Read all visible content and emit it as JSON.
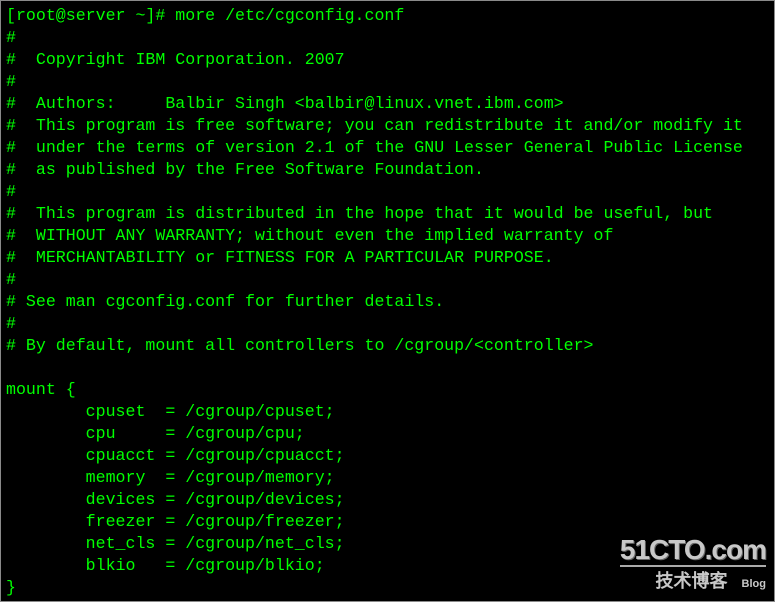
{
  "terminal": {
    "text_color": "#00ff00",
    "background": "#000000",
    "lines": [
      "[root@server ~]# more /etc/cgconfig.conf",
      "#",
      "#  Copyright IBM Corporation. 2007",
      "#",
      "#  Authors:     Balbir Singh <balbir@linux.vnet.ibm.com>",
      "#  This program is free software; you can redistribute it and/or modify it",
      "#  under the terms of version 2.1 of the GNU Lesser General Public License",
      "#  as published by the Free Software Foundation.",
      "#",
      "#  This program is distributed in the hope that it would be useful, but",
      "#  WITHOUT ANY WARRANTY; without even the implied warranty of",
      "#  MERCHANTABILITY or FITNESS FOR A PARTICULAR PURPOSE.",
      "#",
      "# See man cgconfig.conf for further details.",
      "#",
      "# By default, mount all controllers to /cgroup/<controller>",
      "",
      "mount {",
      "        cpuset  = /cgroup/cpuset;",
      "        cpu     = /cgroup/cpu;",
      "        cpuacct = /cgroup/cpuacct;",
      "        memory  = /cgroup/memory;",
      "        devices = /cgroup/devices;",
      "        freezer = /cgroup/freezer;",
      "        net_cls = /cgroup/net_cls;",
      "        blkio   = /cgroup/blkio;",
      "}"
    ]
  },
  "watermark": {
    "site": "51CTO.com",
    "subtitle": "技术博客",
    "tag": "Blog"
  }
}
